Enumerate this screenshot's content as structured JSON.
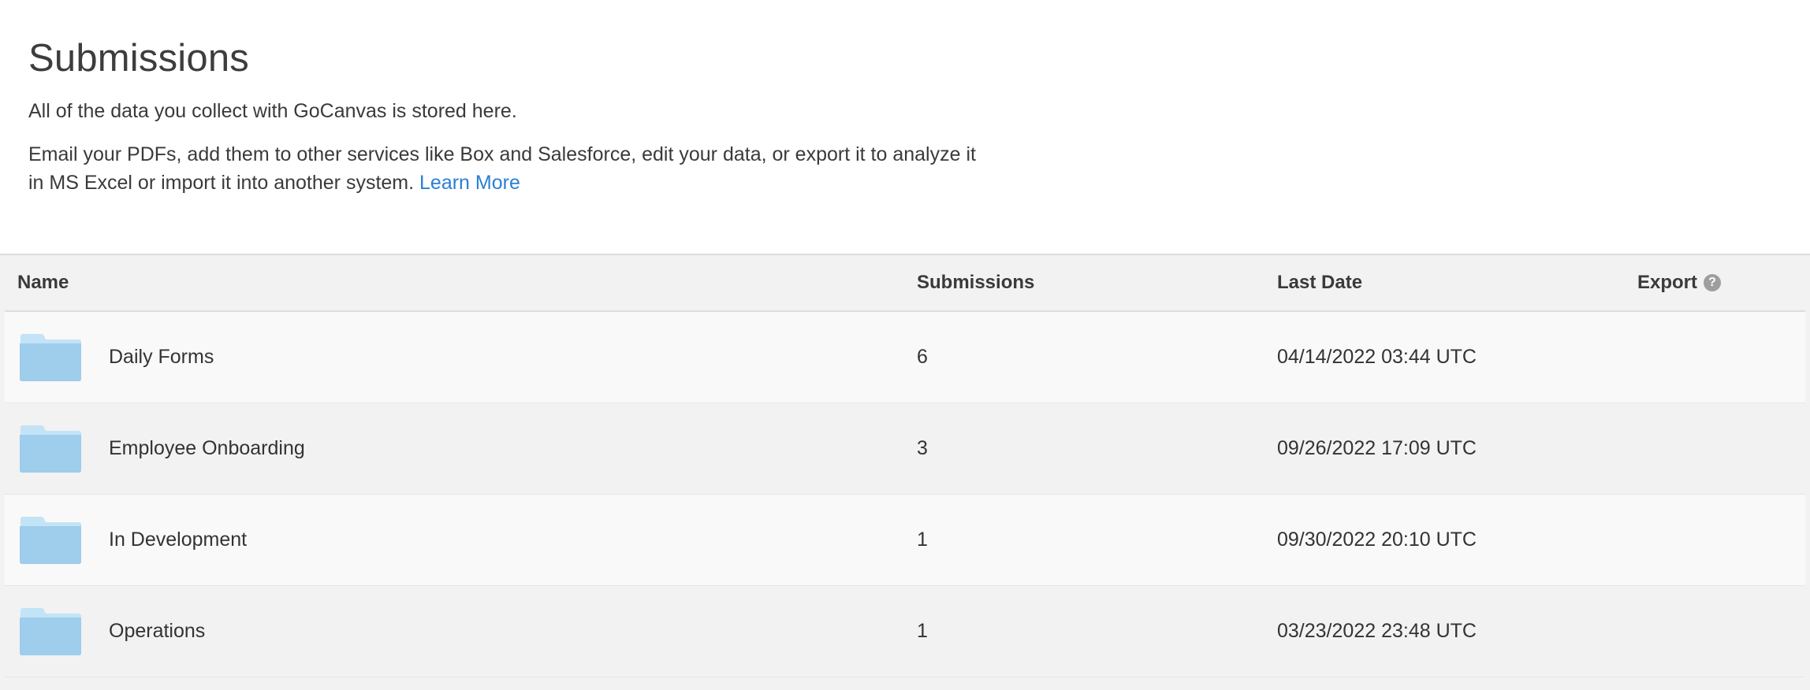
{
  "header": {
    "title": "Submissions",
    "subtitle": "All of the data you collect with GoCanvas is stored here.",
    "description_line1": "Email your PDFs, add them to other services like Box and Salesforce, edit your data, or export it to analyze it",
    "description_line2": "in MS Excel or import it into another system.",
    "learn_more": "Learn More"
  },
  "table": {
    "columns": {
      "name": "Name",
      "submissions": "Submissions",
      "last_date": "Last Date",
      "export": "Export"
    },
    "help_icon": "?",
    "rows": [
      {
        "name": "Daily Forms",
        "submissions": "6",
        "last_date": "04/14/2022 03:44 UTC",
        "icon": "folder-icon"
      },
      {
        "name": "Employee Onboarding",
        "submissions": "3",
        "last_date": "09/26/2022 17:09 UTC",
        "icon": "folder-icon"
      },
      {
        "name": "In Development",
        "submissions": "1",
        "last_date": "09/30/2022 20:10 UTC",
        "icon": "folder-icon"
      },
      {
        "name": "Operations",
        "submissions": "1",
        "last_date": "03/23/2022 23:48 UTC",
        "icon": "folder-icon"
      }
    ]
  },
  "colors": {
    "link": "#2a7fd4",
    "folder_light": "#c3e3f7",
    "folder_dark": "#9fcdec"
  }
}
